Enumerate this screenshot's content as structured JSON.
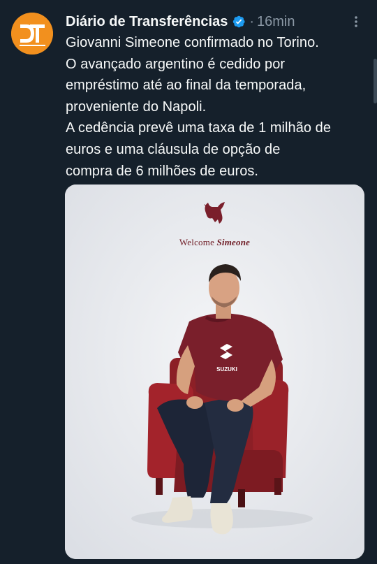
{
  "tweet": {
    "author": {
      "display_name": "Diário de Transferências",
      "avatar_initials": "DT",
      "verified_icon": "verified-badge-icon",
      "avatar_color": "#f2901e"
    },
    "separator": "·",
    "timestamp": "16min",
    "more_icon": "more-options-icon",
    "text_lines": [
      "Giovanni Simeone confirmado no Torino.",
      "O avançado argentino é cedido por",
      "empréstimo até ao final da temporada,",
      "proveniente do Napoli.",
      "A cedência prevê uma taxa de 1 milhão de",
      "euros e uma cláusula de opção de",
      "compra de 6 milhões de euros."
    ],
    "media": {
      "welcome_prefix": "Welcome",
      "welcome_name": "Simeone",
      "shirt_sponsor": "SUZUKI",
      "club_color": "#7a1f2b"
    }
  },
  "theme": {
    "background": "#15202b",
    "text": "#f7f9f9",
    "muted": "#8b98a5",
    "verified": "#1d9bf0"
  }
}
